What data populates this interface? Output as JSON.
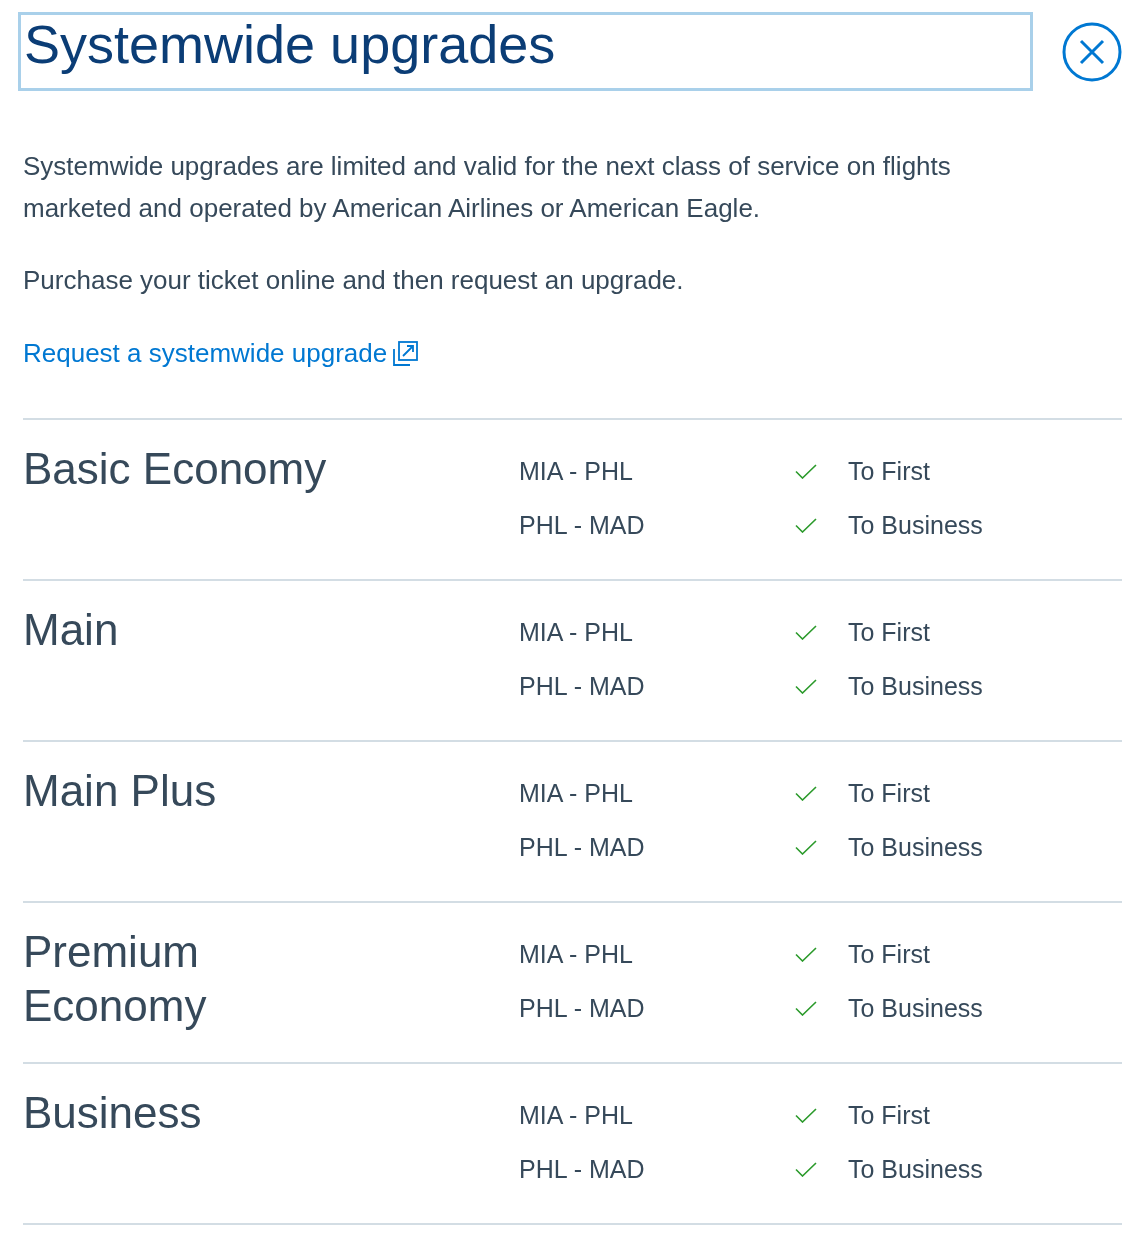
{
  "dialog": {
    "title": "Systemwide upgrades",
    "paragraphs": [
      "Systemwide upgrades are limited and valid for the next class of service on flights marketed and operated by American Airlines or American Eagle.",
      "Purchase your ticket online and then request an upgrade."
    ],
    "link": {
      "label": "Request a systemwide upgrade"
    }
  },
  "fares": [
    {
      "name": "Basic Economy",
      "segments": [
        {
          "route": "MIA - PHL",
          "eligible": true,
          "upgrade": "To First"
        },
        {
          "route": "PHL - MAD",
          "eligible": true,
          "upgrade": "To Business"
        }
      ]
    },
    {
      "name": "Main",
      "segments": [
        {
          "route": "MIA - PHL",
          "eligible": true,
          "upgrade": "To First"
        },
        {
          "route": "PHL - MAD",
          "eligible": true,
          "upgrade": "To Business"
        }
      ]
    },
    {
      "name": "Main Plus",
      "segments": [
        {
          "route": "MIA - PHL",
          "eligible": true,
          "upgrade": "To First"
        },
        {
          "route": "PHL - MAD",
          "eligible": true,
          "upgrade": "To Business"
        }
      ]
    },
    {
      "name": "Premium Economy",
      "segments": [
        {
          "route": "MIA - PHL",
          "eligible": true,
          "upgrade": "To First"
        },
        {
          "route": "PHL - MAD",
          "eligible": true,
          "upgrade": "To Business"
        }
      ]
    },
    {
      "name": "Business",
      "segments": [
        {
          "route": "MIA - PHL",
          "eligible": true,
          "upgrade": "To First"
        },
        {
          "route": "PHL - MAD",
          "eligible": true,
          "upgrade": "To Business"
        }
      ]
    }
  ]
}
